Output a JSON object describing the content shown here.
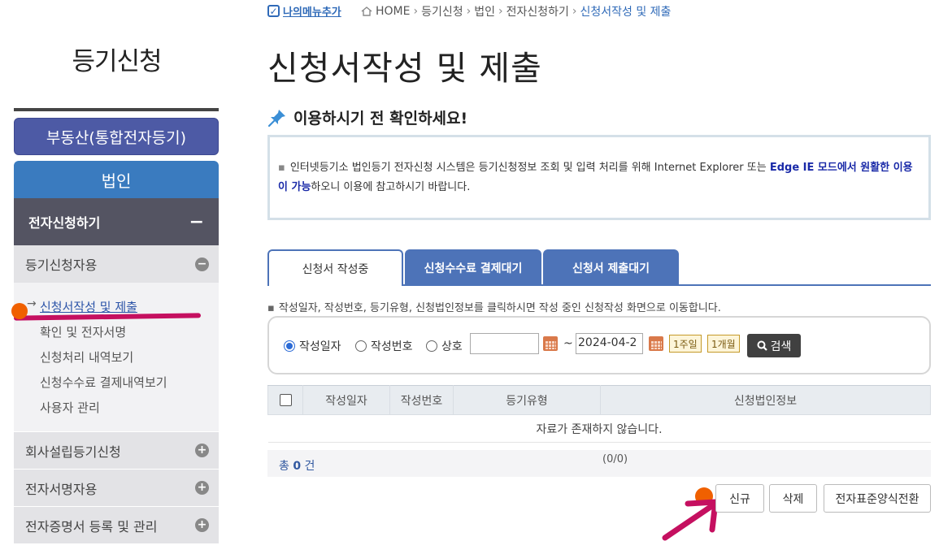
{
  "sidebar": {
    "title": "등기신청",
    "realestate_label": "부동산(통합전자등기)",
    "corp_label": "법인",
    "section": {
      "label": "전자신청하기",
      "toggle": "−"
    },
    "group": {
      "label": "등기신청자용",
      "toggle": "−"
    },
    "submenu": [
      {
        "label": "신청서작성 및 제출",
        "active": true
      },
      {
        "label": "확인 및 전자서명"
      },
      {
        "label": "신청처리 내역보기"
      },
      {
        "label": "신청수수료 결제내역보기"
      },
      {
        "label": "사용자 관리"
      }
    ],
    "bottom": [
      {
        "label": "회사설립등기신청",
        "toggle": "+"
      },
      {
        "label": "전자서명자용",
        "toggle": "+"
      },
      {
        "label": "전자증명서 등록 및 관리",
        "toggle": "+"
      }
    ]
  },
  "topbar": {
    "mymenu_label": "나의메뉴추가",
    "breadcrumb": [
      "HOME",
      "등기신청",
      "법인",
      "전자신청하기",
      "신청서작성 및 제출"
    ]
  },
  "page_title": "신청서작성 및 제출",
  "notice": {
    "heading": "이용하시기 전 확인하세요!",
    "text_before": "인터넷등기소 법인등기 전자신청 시스템은 등기신청정보 조회 및 입력 처리를 위해 Internet Explorer 또는 ",
    "text_highlight": "Edge IE 모드에서 원활한 이용이 가능",
    "text_after": "하오니 이용에 참고하시기 바랍니다."
  },
  "tabs": [
    {
      "label": "신청서 작성중",
      "active": true
    },
    {
      "label": "신청수수료 결제대기"
    },
    {
      "label": "신청서 제출대기"
    }
  ],
  "hint": "작성일자, 작성번호, 등기유형, 신청법인정보를 클릭하시면 작성 중인 신청작성 화면으로 이동합니다.",
  "search": {
    "radios": [
      {
        "label": "작성일자",
        "checked": true
      },
      {
        "label": "작성번호"
      },
      {
        "label": "상호"
      }
    ],
    "date_from": "",
    "tilde": "~",
    "date_to": "2024-04-2",
    "week_label": "1주일",
    "month_label": "1개월",
    "search_label": "검색"
  },
  "table": {
    "headers": [
      "작성일자",
      "작성번호",
      "등기유형",
      "신청법인정보"
    ],
    "empty_message": "자료가 존재하지 않습니다."
  },
  "summary": {
    "total_prefix": "총",
    "total_count": "0",
    "total_suffix": "건",
    "paging": "(0/0)"
  },
  "actions": {
    "new_label": "신규",
    "delete_label": "삭제",
    "convert_label": "전자표준양식전환"
  },
  "colors": {
    "accent_blue": "#4d73b8",
    "annotation_magenta": "#c51060",
    "annotation_orange": "#f06000"
  }
}
